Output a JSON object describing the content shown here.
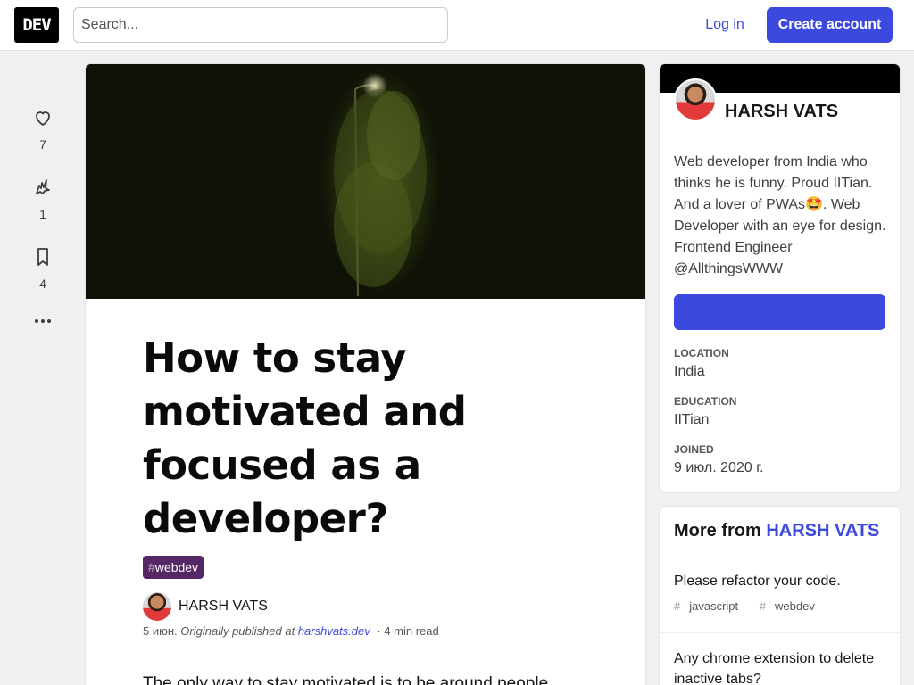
{
  "header": {
    "logo_text": "DEV",
    "search_placeholder": "Search...",
    "login_label": "Log in",
    "create_account_label": "Create account"
  },
  "reactions": {
    "heart_count": "7",
    "unicorn_count": "1",
    "bookmark_count": "4"
  },
  "article": {
    "title": "How to stay motivated and focused as a developer?",
    "tag_hash": "#",
    "tag_name": "webdev",
    "author": "HARSH VATS",
    "date": "5 июн.",
    "originally_published": "Originally published at",
    "source_link": "harshvats.dev",
    "read_time": "· 4 min read",
    "first_line": "The only way to stay motivated is to be around people"
  },
  "profile": {
    "name": "HARSH VATS",
    "bio": "Web developer from India who thinks he is funny. Proud IITian. And a lover of PWAs🤩. Web Developer with an eye for design. Frontend Engineer @AllthingsWWW",
    "location_label": "LOCATION",
    "location": "India",
    "education_label": "EDUCATION",
    "education": "IITian",
    "joined_label": "JOINED",
    "joined": "9 июл. 2020 г."
  },
  "more_from": {
    "prefix": "More from",
    "author": "HARSH VATS",
    "items": [
      {
        "title": "Please refactor your code.",
        "tags": [
          "javascript",
          "webdev"
        ]
      },
      {
        "title": "Any chrome extension to delete inactive tabs?",
        "tags": []
      }
    ]
  },
  "colors": {
    "accent": "#3b49df",
    "tag_bg": "#562765",
    "page_bg": "#eef0f1"
  }
}
